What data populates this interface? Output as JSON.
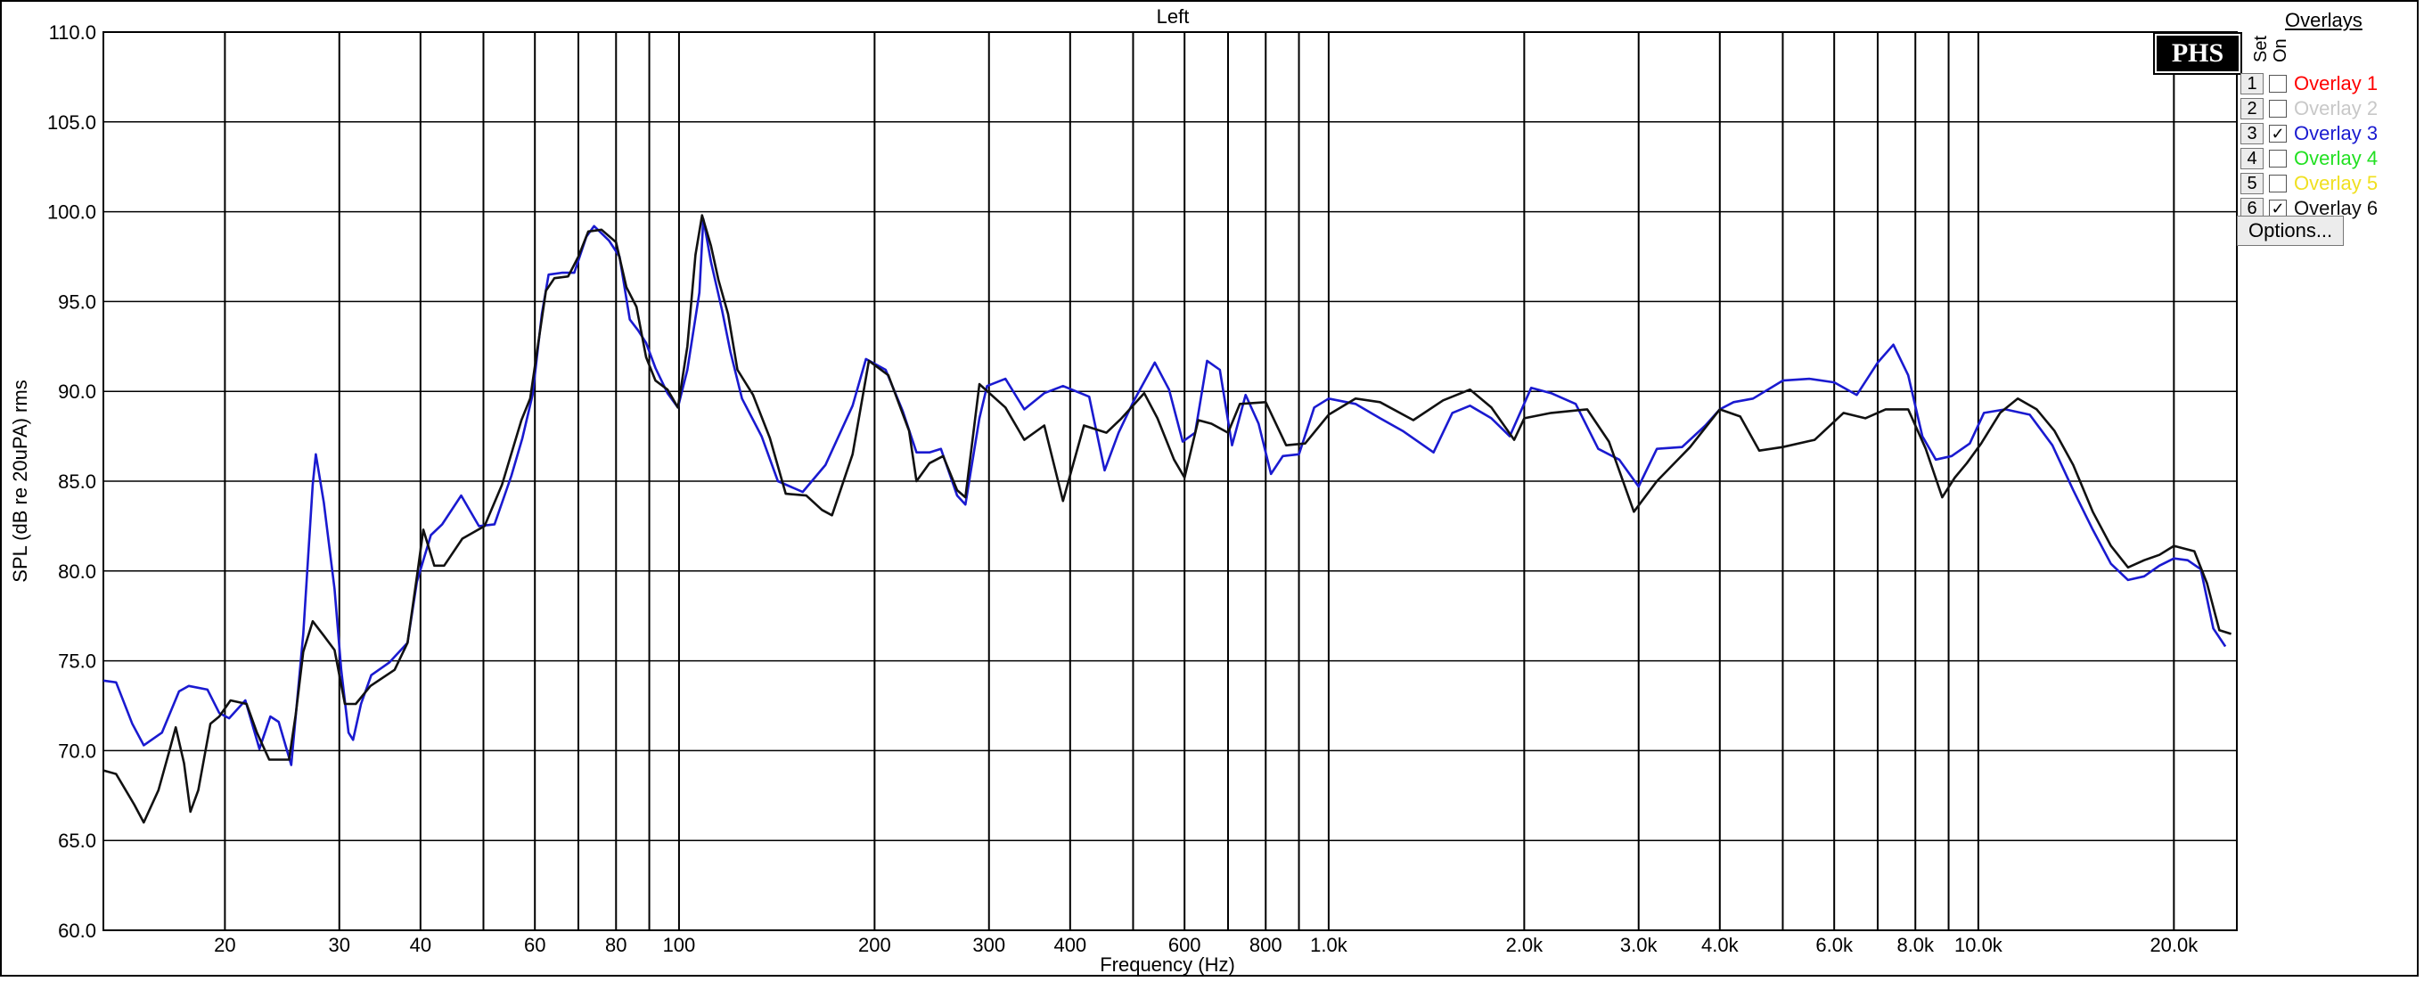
{
  "chart_data": {
    "type": "line",
    "title": "Left",
    "xlabel": "Frequency (Hz)",
    "ylabel": "SPL (dB re 20uPA) rms",
    "x_scale": "log",
    "xlim": [
      13,
      25000
    ],
    "ylim": [
      60,
      110
    ],
    "y_ticks": [
      "60.0",
      "65.0",
      "70.0",
      "75.0",
      "80.0",
      "85.0",
      "90.0",
      "95.0",
      "100.0",
      "105.0",
      "110.0"
    ],
    "y_tick_values": [
      60,
      65,
      70,
      75,
      80,
      85,
      90,
      95,
      100,
      105,
      110
    ],
    "x_tick_labels": [
      {
        "value": 20,
        "label": "20"
      },
      {
        "value": 30,
        "label": "30"
      },
      {
        "value": 40,
        "label": "40"
      },
      {
        "value": 60,
        "label": "60"
      },
      {
        "value": 80,
        "label": "80"
      },
      {
        "value": 100,
        "label": "100"
      },
      {
        "value": 200,
        "label": "200"
      },
      {
        "value": 300,
        "label": "300"
      },
      {
        "value": 400,
        "label": "400"
      },
      {
        "value": 600,
        "label": "600"
      },
      {
        "value": 800,
        "label": "800"
      },
      {
        "value": 1000,
        "label": "1.0k"
      },
      {
        "value": 2000,
        "label": "2.0k"
      },
      {
        "value": 3000,
        "label": "3.0k"
      },
      {
        "value": 4000,
        "label": "4.0k"
      },
      {
        "value": 6000,
        "label": "6.0k"
      },
      {
        "value": 8000,
        "label": "8.0k"
      },
      {
        "value": 10000,
        "label": "10.0k"
      },
      {
        "value": 20000,
        "label": "20.0k"
      }
    ],
    "x_gridlines": [
      20,
      30,
      40,
      50,
      60,
      70,
      80,
      90,
      100,
      200,
      300,
      400,
      500,
      600,
      700,
      800,
      900,
      1000,
      2000,
      3000,
      4000,
      5000,
      6000,
      7000,
      8000,
      9000,
      10000,
      20000
    ],
    "grid": true,
    "legend": "right",
    "series": [
      {
        "name": "Overlay 3",
        "color": "#1a1ad0",
        "points": [
          [
            13,
            73.9
          ],
          [
            13.6,
            73.8
          ],
          [
            14.4,
            71.5
          ],
          [
            15,
            70.3
          ],
          [
            16,
            71
          ],
          [
            17,
            73.3
          ],
          [
            17.6,
            73.6
          ],
          [
            18.8,
            73.4
          ],
          [
            19.6,
            72.1
          ],
          [
            20.3,
            71.8
          ],
          [
            21.5,
            72.8
          ],
          [
            22.6,
            70.1
          ],
          [
            23.5,
            71.9
          ],
          [
            24.2,
            71.6
          ],
          [
            25.3,
            69.2
          ],
          [
            26.4,
            76.5
          ],
          [
            27.3,
            84.8
          ],
          [
            27.6,
            86.5
          ],
          [
            28.4,
            83.8
          ],
          [
            29.5,
            79
          ],
          [
            30.2,
            74.5
          ],
          [
            31,
            71
          ],
          [
            31.5,
            70.6
          ],
          [
            32.4,
            72.6
          ],
          [
            33.6,
            74.2
          ],
          [
            35.8,
            74.9
          ],
          [
            38.2,
            76
          ],
          [
            39.5,
            79.4
          ],
          [
            41.5,
            82
          ],
          [
            43.2,
            82.6
          ],
          [
            46.2,
            84.2
          ],
          [
            49.2,
            82.5
          ],
          [
            52,
            82.6
          ],
          [
            55.2,
            85.3
          ],
          [
            57.4,
            87.4
          ],
          [
            59.5,
            89.8
          ],
          [
            61.5,
            94.3
          ],
          [
            63,
            96.5
          ],
          [
            66,
            96.6
          ],
          [
            69,
            96.6
          ],
          [
            72,
            98.6
          ],
          [
            74,
            99.2
          ],
          [
            78,
            98.4
          ],
          [
            81,
            97.5
          ],
          [
            84,
            94
          ],
          [
            86.5,
            93.4
          ],
          [
            89,
            92.7
          ],
          [
            92,
            91.3
          ],
          [
            96,
            89.9
          ],
          [
            99.6,
            89.1
          ],
          [
            103,
            91.2
          ],
          [
            107.5,
            95.5
          ],
          [
            109,
            99.6
          ],
          [
            112,
            97.2
          ],
          [
            116.5,
            94.5
          ],
          [
            120,
            92.2
          ],
          [
            125,
            89.6
          ],
          [
            134,
            87.5
          ],
          [
            142,
            85
          ],
          [
            155,
            84.4
          ],
          [
            168,
            85.9
          ],
          [
            185,
            89.2
          ],
          [
            194,
            91.8
          ],
          [
            208,
            91.2
          ],
          [
            221,
            88.9
          ],
          [
            232,
            86.6
          ],
          [
            243,
            86.6
          ],
          [
            253,
            86.8
          ],
          [
            268,
            84.2
          ],
          [
            276,
            83.7
          ],
          [
            290,
            88.5
          ],
          [
            298,
            90.3
          ],
          [
            318,
            90.7
          ],
          [
            340,
            89
          ],
          [
            365,
            89.9
          ],
          [
            390,
            90.3
          ],
          [
            428,
            89.7
          ],
          [
            452,
            85.6
          ],
          [
            475,
            87.7
          ],
          [
            500,
            89.4
          ],
          [
            540,
            91.6
          ],
          [
            568,
            90.1
          ],
          [
            596,
            87.2
          ],
          [
            623,
            87.7
          ],
          [
            650,
            91.7
          ],
          [
            680,
            91.2
          ],
          [
            710,
            87
          ],
          [
            745,
            89.8
          ],
          [
            780,
            88.2
          ],
          [
            815,
            85.4
          ],
          [
            850,
            86.4
          ],
          [
            900,
            86.5
          ],
          [
            950,
            89.1
          ],
          [
            1000,
            89.6
          ],
          [
            1100,
            89.3
          ],
          [
            1200,
            88.5
          ],
          [
            1300,
            87.8
          ],
          [
            1450,
            86.6
          ],
          [
            1550,
            88.8
          ],
          [
            1650,
            89.2
          ],
          [
            1780,
            88.5
          ],
          [
            1900,
            87.5
          ],
          [
            2050,
            90.2
          ],
          [
            2200,
            89.9
          ],
          [
            2400,
            89.3
          ],
          [
            2600,
            86.8
          ],
          [
            2800,
            86.2
          ],
          [
            3000,
            84.7
          ],
          [
            3200,
            86.8
          ],
          [
            3500,
            86.9
          ],
          [
            3800,
            88.1
          ],
          [
            4000,
            89
          ],
          [
            4200,
            89.4
          ],
          [
            4500,
            89.6
          ],
          [
            5000,
            90.6
          ],
          [
            5500,
            90.7
          ],
          [
            6000,
            90.5
          ],
          [
            6500,
            89.8
          ],
          [
            7000,
            91.6
          ],
          [
            7400,
            92.6
          ],
          [
            7800,
            90.9
          ],
          [
            8200,
            87.5
          ],
          [
            8600,
            86.2
          ],
          [
            9100,
            86.4
          ],
          [
            9700,
            87.1
          ],
          [
            10200,
            88.8
          ],
          [
            11000,
            89
          ],
          [
            12000,
            88.7
          ],
          [
            13000,
            87
          ],
          [
            14000,
            84.5
          ],
          [
            15000,
            82.3
          ],
          [
            16000,
            80.4
          ],
          [
            17000,
            79.5
          ],
          [
            18000,
            79.7
          ],
          [
            19000,
            80.3
          ],
          [
            20000,
            80.7
          ],
          [
            21000,
            80.6
          ],
          [
            22000,
            80.1
          ],
          [
            23000,
            76.8
          ],
          [
            24000,
            75.8
          ]
        ]
      },
      {
        "name": "Overlay 6",
        "color": "#111111",
        "points": [
          [
            13,
            68.9
          ],
          [
            13.6,
            68.7
          ],
          [
            14.5,
            67
          ],
          [
            15,
            66
          ],
          [
            15.8,
            67.8
          ],
          [
            16.4,
            69.9
          ],
          [
            16.8,
            71.3
          ],
          [
            17.3,
            69.3
          ],
          [
            17.7,
            66.6
          ],
          [
            18.2,
            67.8
          ],
          [
            19,
            71.5
          ],
          [
            19.6,
            71.9
          ],
          [
            20.4,
            72.8
          ],
          [
            21.6,
            72.6
          ],
          [
            22.4,
            71
          ],
          [
            23.4,
            69.5
          ],
          [
            25.1,
            69.5
          ],
          [
            25.7,
            72
          ],
          [
            26.4,
            75.5
          ],
          [
            27.3,
            77.2
          ],
          [
            28.4,
            76.4
          ],
          [
            29.5,
            75.6
          ],
          [
            30.6,
            72.6
          ],
          [
            31.8,
            72.6
          ],
          [
            33.5,
            73.6
          ],
          [
            36.5,
            74.5
          ],
          [
            38.2,
            76
          ],
          [
            39.6,
            80
          ],
          [
            40.4,
            82.3
          ],
          [
            42,
            80.3
          ],
          [
            43.5,
            80.3
          ],
          [
            46.4,
            81.8
          ],
          [
            50.2,
            82.5
          ],
          [
            53.4,
            84.8
          ],
          [
            57.2,
            88.4
          ],
          [
            59,
            89.6
          ],
          [
            62.4,
            95.6
          ],
          [
            64.3,
            96.3
          ],
          [
            67.5,
            96.4
          ],
          [
            70,
            97.5
          ],
          [
            72.5,
            98.9
          ],
          [
            76,
            99
          ],
          [
            80,
            98.3
          ],
          [
            83,
            95.8
          ],
          [
            86,
            94.7
          ],
          [
            89,
            91.9
          ],
          [
            92,
            90.6
          ],
          [
            96,
            90.1
          ],
          [
            99.6,
            89.1
          ],
          [
            103,
            92.5
          ],
          [
            106,
            97.6
          ],
          [
            108.5,
            99.8
          ],
          [
            112,
            98.1
          ],
          [
            115,
            96.2
          ],
          [
            119,
            94.3
          ],
          [
            123,
            91.2
          ],
          [
            130,
            89.8
          ],
          [
            138,
            87.4
          ],
          [
            146,
            84.3
          ],
          [
            157,
            84.2
          ],
          [
            166,
            83.4
          ],
          [
            172,
            83.1
          ],
          [
            185,
            86.5
          ],
          [
            196,
            91.7
          ],
          [
            210,
            90.9
          ],
          [
            226,
            87.8
          ],
          [
            232,
            85
          ],
          [
            243,
            86
          ],
          [
            255,
            86.4
          ],
          [
            268,
            84.5
          ],
          [
            276,
            84.1
          ],
          [
            290,
            90.4
          ],
          [
            318,
            89.1
          ],
          [
            340,
            87.3
          ],
          [
            365,
            88.1
          ],
          [
            390,
            83.9
          ],
          [
            420,
            88.1
          ],
          [
            455,
            87.7
          ],
          [
            480,
            88.5
          ],
          [
            520,
            89.9
          ],
          [
            545,
            88.5
          ],
          [
            578,
            86.2
          ],
          [
            600,
            85.2
          ],
          [
            630,
            88.4
          ],
          [
            660,
            88.2
          ],
          [
            700,
            87.7
          ],
          [
            730,
            89.3
          ],
          [
            800,
            89.4
          ],
          [
            860,
            87
          ],
          [
            920,
            87.1
          ],
          [
            1000,
            88.7
          ],
          [
            1100,
            89.6
          ],
          [
            1200,
            89.4
          ],
          [
            1350,
            88.4
          ],
          [
            1500,
            89.5
          ],
          [
            1650,
            90.1
          ],
          [
            1780,
            89.1
          ],
          [
            1930,
            87.3
          ],
          [
            2000,
            88.5
          ],
          [
            2200,
            88.8
          ],
          [
            2500,
            89
          ],
          [
            2700,
            87.2
          ],
          [
            2950,
            83.3
          ],
          [
            3200,
            85
          ],
          [
            3600,
            86.9
          ],
          [
            4000,
            89
          ],
          [
            4300,
            88.6
          ],
          [
            4600,
            86.7
          ],
          [
            5000,
            86.9
          ],
          [
            5600,
            87.3
          ],
          [
            6200,
            88.8
          ],
          [
            6700,
            88.5
          ],
          [
            7200,
            89
          ],
          [
            7800,
            89
          ],
          [
            8300,
            86.8
          ],
          [
            8800,
            84.1
          ],
          [
            9200,
            85.2
          ],
          [
            9600,
            86
          ],
          [
            10100,
            87.1
          ],
          [
            10800,
            88.8
          ],
          [
            11500,
            89.6
          ],
          [
            12300,
            89
          ],
          [
            13100,
            87.8
          ],
          [
            14000,
            85.9
          ],
          [
            15000,
            83.3
          ],
          [
            16000,
            81.4
          ],
          [
            17000,
            80.2
          ],
          [
            18000,
            80.6
          ],
          [
            19000,
            80.9
          ],
          [
            20000,
            81.4
          ],
          [
            21500,
            81.1
          ],
          [
            22500,
            79.3
          ],
          [
            23500,
            76.7
          ],
          [
            24500,
            76.5
          ]
        ]
      }
    ]
  },
  "overlays_panel": {
    "title": "Overlays",
    "col_set": "Set",
    "col_on": "On",
    "check_mark": "✓",
    "items": [
      {
        "set": "1",
        "label": "Overlay 1",
        "color": "#ff0000",
        "checked": false
      },
      {
        "set": "2",
        "label": "Overlay 2",
        "color": "#c8c8c8",
        "checked": false
      },
      {
        "set": "3",
        "label": "Overlay 3",
        "color": "#1a1ad0",
        "checked": true
      },
      {
        "set": "4",
        "label": "Overlay 4",
        "color": "#22e022",
        "checked": false
      },
      {
        "set": "5",
        "label": "Overlay 5",
        "color": "#f0e020",
        "checked": false
      },
      {
        "set": "6",
        "label": "Overlay 6",
        "color": "#111111",
        "checked": true
      }
    ],
    "options_label": "Options..."
  },
  "logo_text": "PHS"
}
